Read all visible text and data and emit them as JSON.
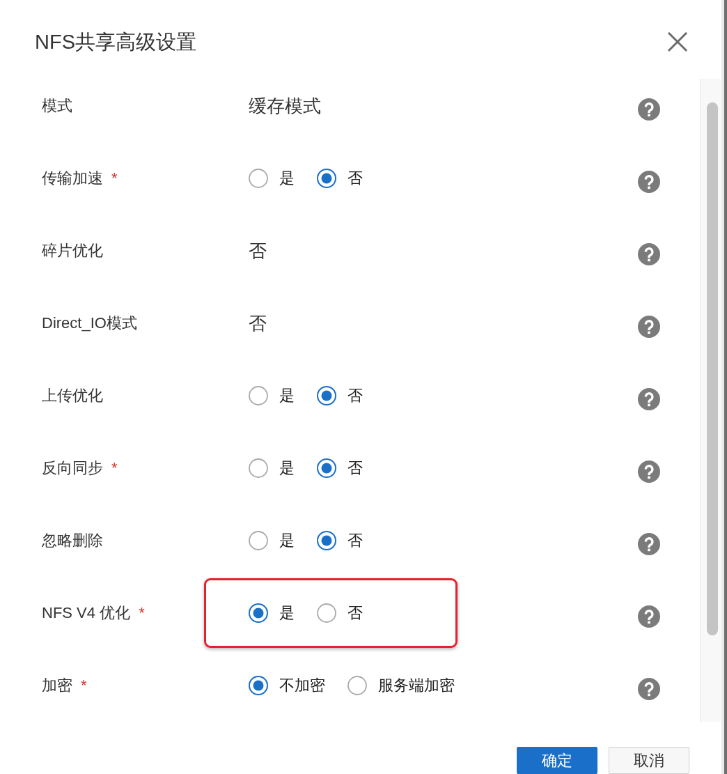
{
  "dialog": {
    "title": "NFS共享高级设置"
  },
  "rows": [
    {
      "kind": "text",
      "label": "模式",
      "value": "缓存模式",
      "highlighted": false
    },
    {
      "kind": "radio",
      "label": "传输加速",
      "required_mark": "*",
      "options": [
        {
          "label": "是",
          "selected": false
        },
        {
          "label": "否",
          "selected": true
        }
      ],
      "highlighted": false
    },
    {
      "kind": "text",
      "label": "碎片优化",
      "value": "否",
      "highlighted": false
    },
    {
      "kind": "text",
      "label": "Direct_IO模式",
      "value": "否",
      "highlighted": false
    },
    {
      "kind": "radio",
      "label": "上传优化",
      "options": [
        {
          "label": "是",
          "selected": false
        },
        {
          "label": "否",
          "selected": true
        }
      ],
      "highlighted": false
    },
    {
      "kind": "radio",
      "label": "反向同步",
      "required_mark": "*",
      "options": [
        {
          "label": "是",
          "selected": false
        },
        {
          "label": "否",
          "selected": true
        }
      ],
      "highlighted": false
    },
    {
      "kind": "radio",
      "label": "忽略删除",
      "options": [
        {
          "label": "是",
          "selected": false
        },
        {
          "label": "否",
          "selected": true
        }
      ],
      "highlighted": false
    },
    {
      "kind": "radio",
      "label": "NFS V4 优化",
      "required_mark": "*",
      "options": [
        {
          "label": "是",
          "selected": true
        },
        {
          "label": "否",
          "selected": false
        }
      ],
      "highlighted": true
    },
    {
      "kind": "radio",
      "label": "加密",
      "required_mark": "*",
      "options": [
        {
          "label": "不加密",
          "selected": true
        },
        {
          "label": "服务端加密",
          "selected": false
        }
      ],
      "highlighted": false
    }
  ],
  "buttons": [
    {
      "label": "确定",
      "kind": "primary"
    },
    {
      "label": "取消",
      "kind": "secondary"
    }
  ]
}
